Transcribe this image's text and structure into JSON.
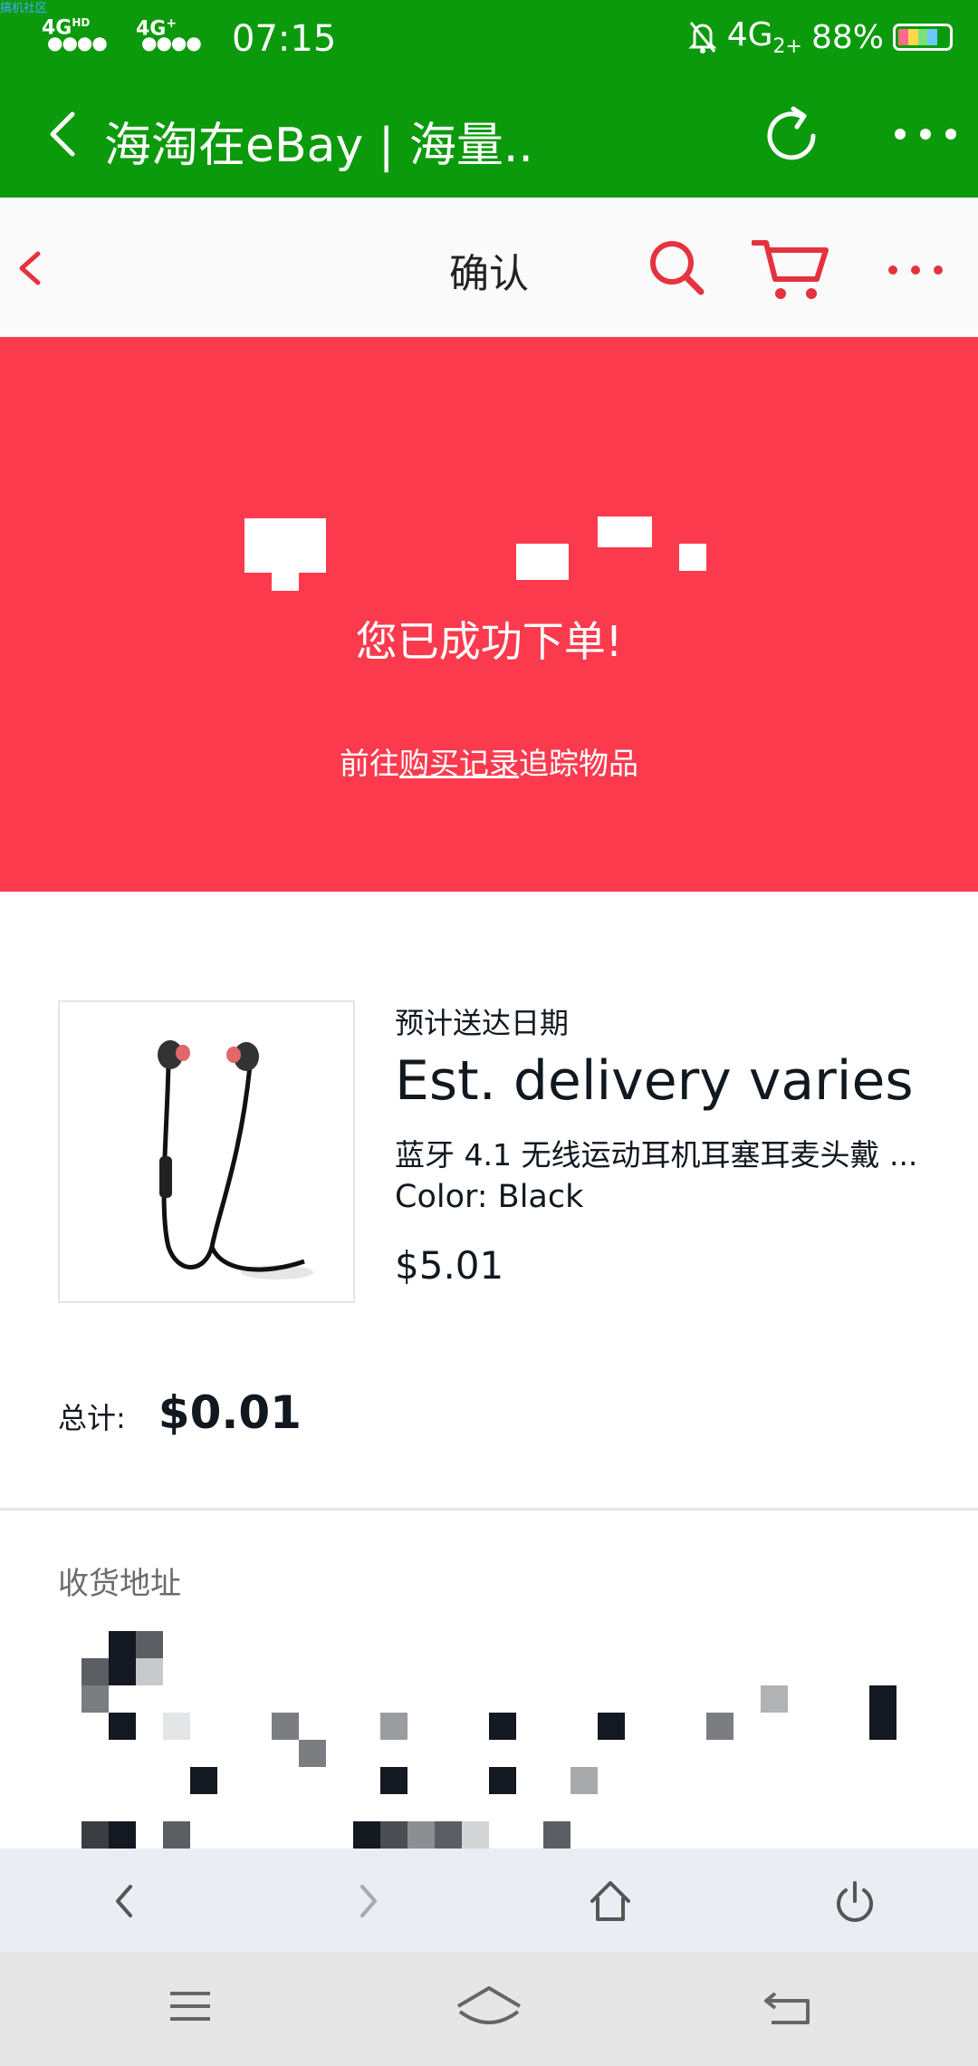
{
  "status_bar": {
    "watermark": "搞机社区",
    "network_1": "4G",
    "network_1_sup": "HD",
    "network_2": "4G",
    "network_2_sup": "+",
    "time": "07:15",
    "right_network": "4G",
    "right_network_sup": "2+",
    "battery": "88%",
    "battery_level": 0.88
  },
  "browser": {
    "title": "海淘在eBay | 海量.."
  },
  "header": {
    "title": "确认",
    "accent_color": "#e5323f"
  },
  "banner": {
    "message": "您已成功下单!",
    "sub_prefix": "前往",
    "sub_link": "购买记录",
    "sub_suffix": "追踪物品",
    "color": "#fb3a4e"
  },
  "item": {
    "image_icon": "earphones-image",
    "eta_label": "预计送达日期",
    "eta": "Est. delivery varies",
    "title": "蓝牙 4.1 无线运动耳机耳塞耳麦头戴 ...",
    "color": "Color: Black",
    "price": "$5.01"
  },
  "total": {
    "label": "总计:",
    "value": "$0.01"
  },
  "address": {
    "label": "收货地址"
  }
}
